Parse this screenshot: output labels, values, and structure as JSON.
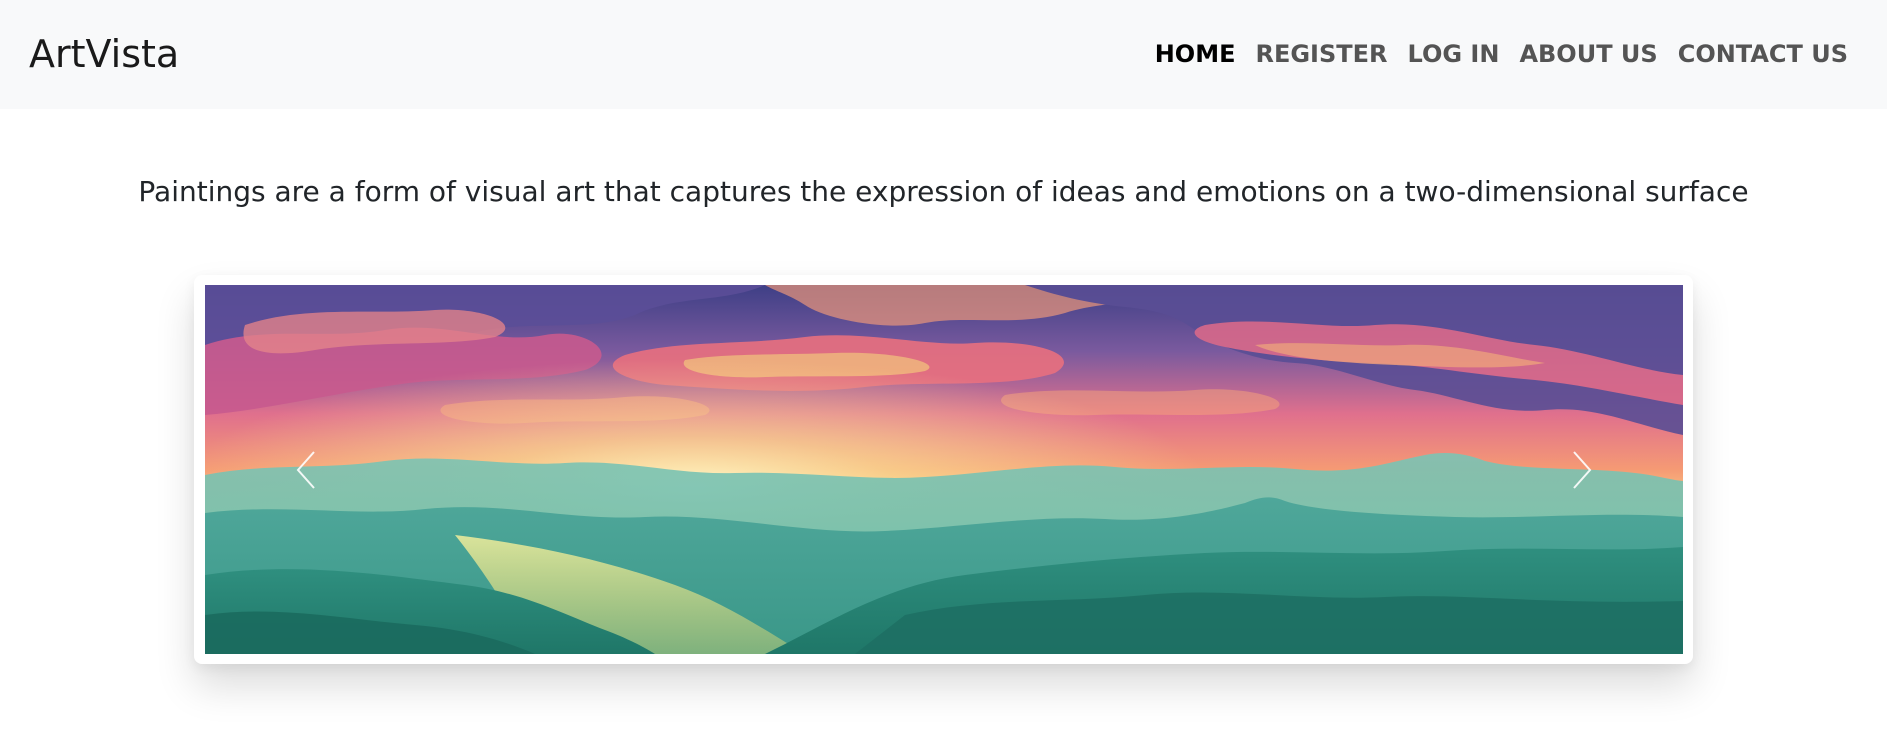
{
  "brand": {
    "name": "ArtVista"
  },
  "nav": {
    "items": [
      {
        "label": "HOME",
        "active": true
      },
      {
        "label": "REGISTER",
        "active": false
      },
      {
        "label": "LOG IN",
        "active": false
      },
      {
        "label": "ABOUT US",
        "active": false
      },
      {
        "label": "CONTACT US",
        "active": false
      }
    ]
  },
  "main": {
    "lead": "Paintings are a form of visual art that captures the expression of ideas and emotions on a two-dimensional surface"
  },
  "carousel": {
    "prev_icon": "chevron-left-icon",
    "next_icon": "chevron-right-icon",
    "slide_image": "landscape-sunset-painting"
  },
  "colors": {
    "navbar_bg": "#f8f9fa",
    "nav_active": "#000000",
    "nav_inactive": "#545454",
    "sky_top": "#4a4a8c",
    "sky_mid": "#f0808a",
    "horizon": "#f7e89a",
    "hills": "#2f9a8a"
  }
}
